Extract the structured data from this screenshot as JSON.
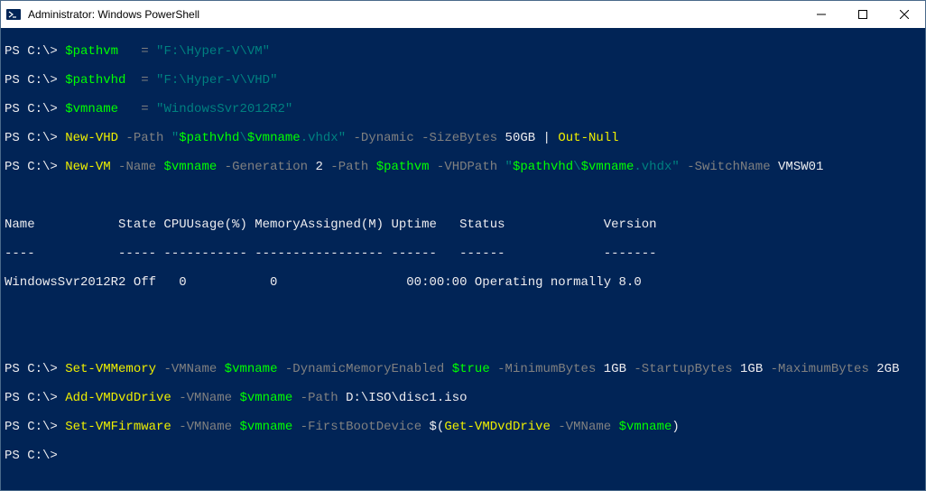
{
  "titlebar": {
    "title": "Administrator: Windows PowerShell"
  },
  "prompt": "PS C:\\> ",
  "lines": {
    "l1": {
      "var": "$pathvm",
      "eq": "   = ",
      "str": "\"F:\\Hyper-V\\VM\""
    },
    "l2": {
      "var": "$pathvhd",
      "eq": "  = ",
      "str": "\"F:\\Hyper-V\\VHD\""
    },
    "l3": {
      "var": "$vmname",
      "eq": "   = ",
      "str": "\"WindowsSvr2012R2\""
    },
    "l4": {
      "cmd": "New-VHD",
      "p1": " -Path ",
      "sq1": "\"",
      "v1": "$pathvhd",
      "bs": "\\",
      "v2": "$vmname",
      "ext": ".vhdx",
      "sq2": "\"",
      "p2": " -Dynamic -SizeBytes ",
      "size": "50GB",
      "pipe": " | ",
      "cmd2": "Out-Null"
    },
    "l5": {
      "cmd": "New-VM",
      "p1": " -Name ",
      "v1": "$vmname",
      "p2": " -Generation ",
      "gen": "2",
      "p3": " -Path ",
      "v2": "$pathvm",
      "p4": " -VHDPath ",
      "sq1": "\"",
      "v3": "$pathvhd",
      "bs": "\\",
      "v4": "$vmname",
      "ext": ".vhdx",
      "sq2": "\"",
      "p5": " -SwitchName ",
      "sw": "VMSW01"
    },
    "hdr": "Name           State CPUUsage(%) MemoryAssigned(M) Uptime   Status             Version",
    "sep": "----           ----- ----------- ----------------- ------   ------             -------",
    "row": "WindowsSvr2012R2 Off   0           0                 00:00:00 Operating normally 8.0",
    "l6": {
      "cmd": "Set-VMMemory",
      "p1": " -VMName ",
      "v1": "$vmname",
      "p2": " -DynamicMemoryEnabled ",
      "tr": "$true",
      "p3": " -MinimumBytes ",
      "m1": "1GB",
      "p4": " -StartupBytes ",
      "m2": "1GB",
      "p5": " -MaximumBytes ",
      "m3": "2GB"
    },
    "l7": {
      "cmd": "Add-VMDvdDrive",
      "p1": " -VMName ",
      "v1": "$vmname",
      "p2": " -Path ",
      "path": "D:\\ISO\\disc1.iso"
    },
    "l8": {
      "cmd": "Set-VMFirmware",
      "p1": " -VMName ",
      "v1": "$vmname",
      "p2": " -FirstBootDevice ",
      "d1": "$(",
      "cmd2": "Get-VMDvdDrive",
      "p3": " -VMName ",
      "v2": "$vmname",
      "d2": ")"
    }
  }
}
